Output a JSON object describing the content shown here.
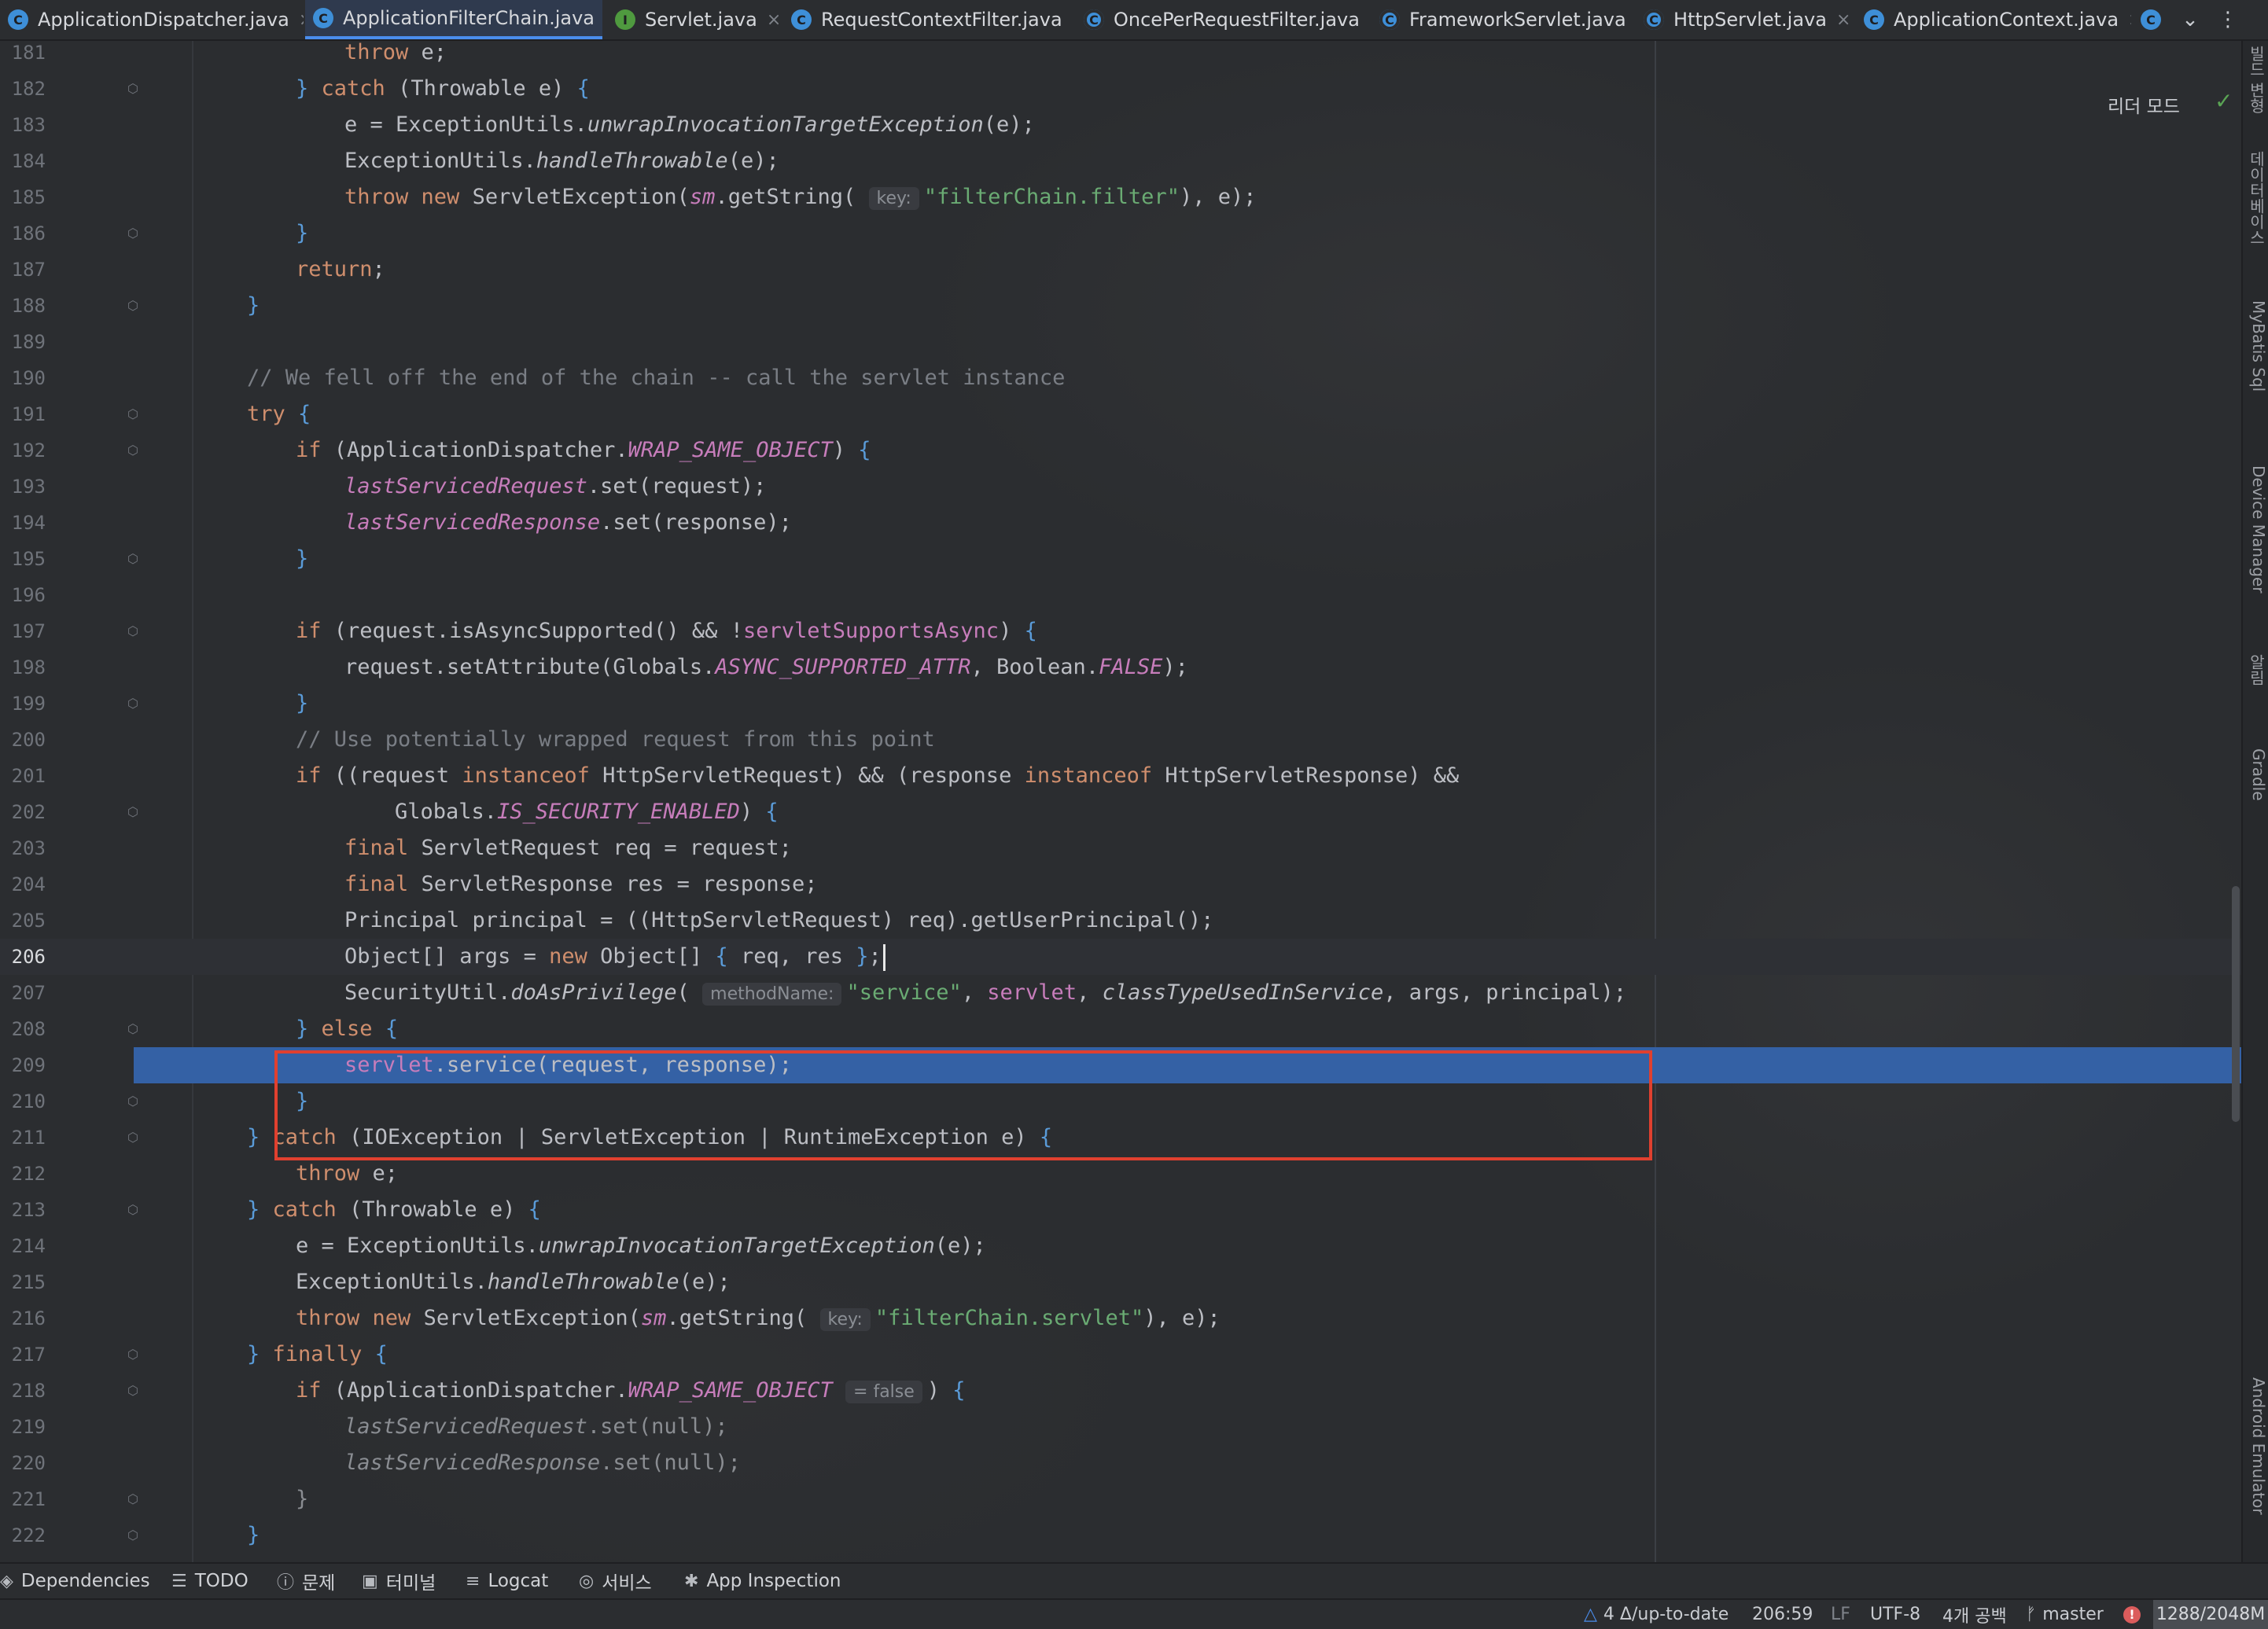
{
  "tabs": [
    {
      "label": "ApplicationDispatcher.java",
      "icon": "class-icon",
      "active": false
    },
    {
      "label": "ApplicationFilterChain.java",
      "icon": "class-icon",
      "active": true
    },
    {
      "label": "Servlet.java",
      "icon": "interface-icon",
      "active": false
    },
    {
      "label": "RequestContextFilter.java",
      "icon": "class-icon",
      "active": false
    },
    {
      "label": "OncePerRequestFilter.java",
      "icon": "abstract-class-icon",
      "active": false
    },
    {
      "label": "FrameworkServlet.java",
      "icon": "abstract-class-icon",
      "active": false
    },
    {
      "label": "HttpServlet.java",
      "icon": "abstract-class-icon",
      "active": false
    },
    {
      "label": "ApplicationContext.java",
      "icon": "class-icon",
      "active": false
    }
  ],
  "reader_mode_label": "리더 모드",
  "editor": {
    "current_line": 206,
    "selected_line": 209,
    "lines": [
      181,
      182,
      183,
      184,
      185,
      186,
      187,
      188,
      189,
      190,
      191,
      192,
      193,
      194,
      195,
      196,
      197,
      198,
      199,
      200,
      201,
      202,
      203,
      204,
      205,
      206,
      207,
      208,
      209,
      210,
      211,
      212,
      213,
      214,
      215,
      216,
      217,
      218,
      219,
      220,
      221,
      222
    ],
    "hint_key": "key:",
    "hint_method_name": "methodName:",
    "hint_false": "= false",
    "str_filter": "\"filterChain.filter\"",
    "str_service": "\"service\"",
    "str_servlet": "\"filterChain.servlet\"",
    "comment_190": "// We fell off the end of the chain -- call the servlet instance",
    "comment_200": "// Use potentially wrapped request from this point"
  },
  "side_tools": [
    "빌드 변형",
    "데이터베이스",
    "MyBatis Sql",
    "Device Manager",
    "알림",
    "Gradle",
    "Android Emulator"
  ],
  "bottom_tools": [
    {
      "label": "Dependencies",
      "icon": "dependencies-icon"
    },
    {
      "label": "TODO",
      "icon": "list-icon"
    },
    {
      "label": "문제",
      "icon": "info-icon"
    },
    {
      "label": "터미널",
      "icon": "terminal-icon"
    },
    {
      "label": "Logcat",
      "icon": "logcat-icon"
    },
    {
      "label": "서비스",
      "icon": "services-icon"
    },
    {
      "label": "App Inspection",
      "icon": "inspection-icon"
    }
  ],
  "status": {
    "vcs": "4 Δ/up-to-date",
    "position": "206:59",
    "line_sep": "LF",
    "encoding": "UTF-8",
    "indent": "4개 공백",
    "branch": "master",
    "memory": "1288/2048M"
  },
  "colors": {
    "selection": "#3461a5",
    "highlight_box": "#e0402f",
    "keyword": "#cf8e6d",
    "string": "#6aab73",
    "static_field": "#c77dbb"
  }
}
